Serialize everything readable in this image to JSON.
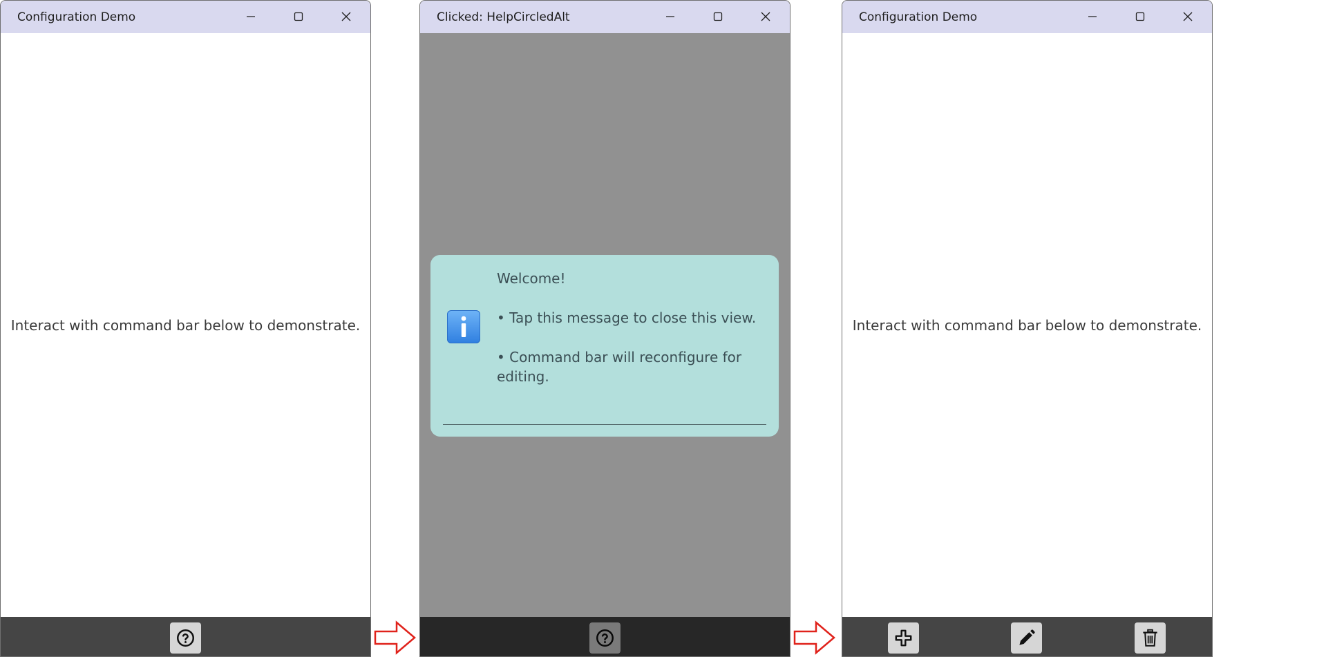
{
  "colors": {
    "titlebar": "#d9d9ef",
    "command_bar": "#454545",
    "button_face": "#d6d6d6",
    "toast_background": "#b3dfdc",
    "info_icon": "#3b8eea",
    "arrow": "#e0221b"
  },
  "windows": [
    {
      "title": "Configuration Demo",
      "message": "Interact with command bar below to demonstrate.",
      "command_bar": [
        {
          "icon": "help-circled-icon"
        }
      ]
    },
    {
      "title": "Clicked: HelpCircledAlt",
      "toast": {
        "icon": "info-icon",
        "lines": [
          "Welcome!",
          "• Tap this message to close this view.",
          "• Command bar will reconfigure for editing."
        ]
      },
      "command_bar": [
        {
          "icon": "help-circled-icon"
        }
      ]
    },
    {
      "title": "Configuration Demo",
      "message": "Interact with command bar below to demonstrate.",
      "command_bar": [
        {
          "icon": "add-icon"
        },
        {
          "icon": "edit-icon"
        },
        {
          "icon": "delete-icon"
        }
      ]
    }
  ],
  "window_controls": [
    "minimize-icon",
    "maximize-icon",
    "close-icon"
  ],
  "transition_arrows": [
    "arrow-right-icon",
    "arrow-right-icon"
  ]
}
